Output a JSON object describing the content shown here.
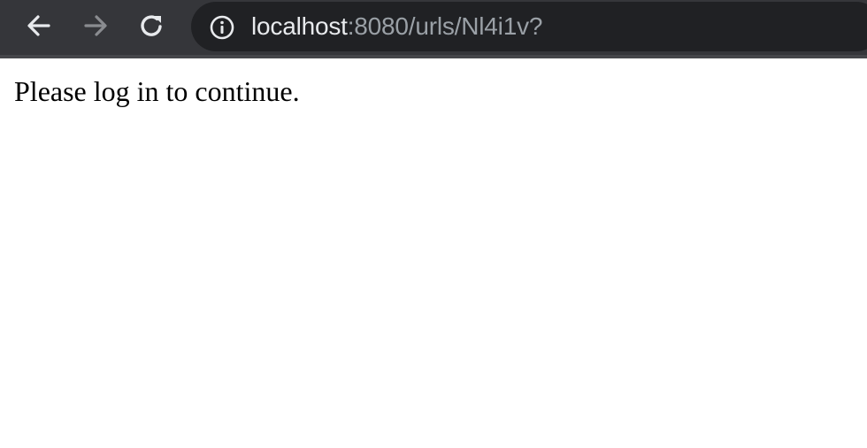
{
  "browser": {
    "back_icon": "arrow-left-icon",
    "forward_icon": "arrow-right-icon",
    "reload_icon": "reload-icon",
    "info_icon": "info-icon",
    "url_host": "localhost",
    "url_rest": ":8080/urls/Nl4i1v?"
  },
  "page": {
    "message": "Please log in to continue."
  }
}
